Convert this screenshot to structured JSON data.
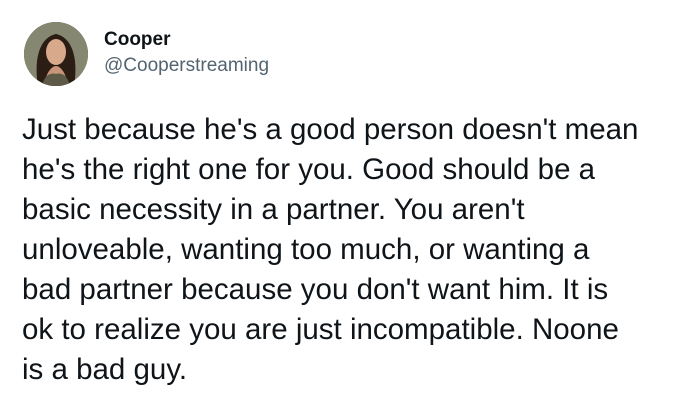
{
  "author": {
    "display_name": "Cooper",
    "handle": "@Cooperstreaming",
    "avatar_icon": "profile-photo"
  },
  "tweet": {
    "lines": [
      "Just because he's a good person doesn't mean",
      "he's the right one for you. Good should be a",
      "basic necessity in a partner. You aren't",
      "unloveable, wanting too much, or wanting a",
      "bad partner because you don't want him. It is",
      "ok to realize you are just incompatible. Noone",
      "is a bad guy."
    ]
  }
}
